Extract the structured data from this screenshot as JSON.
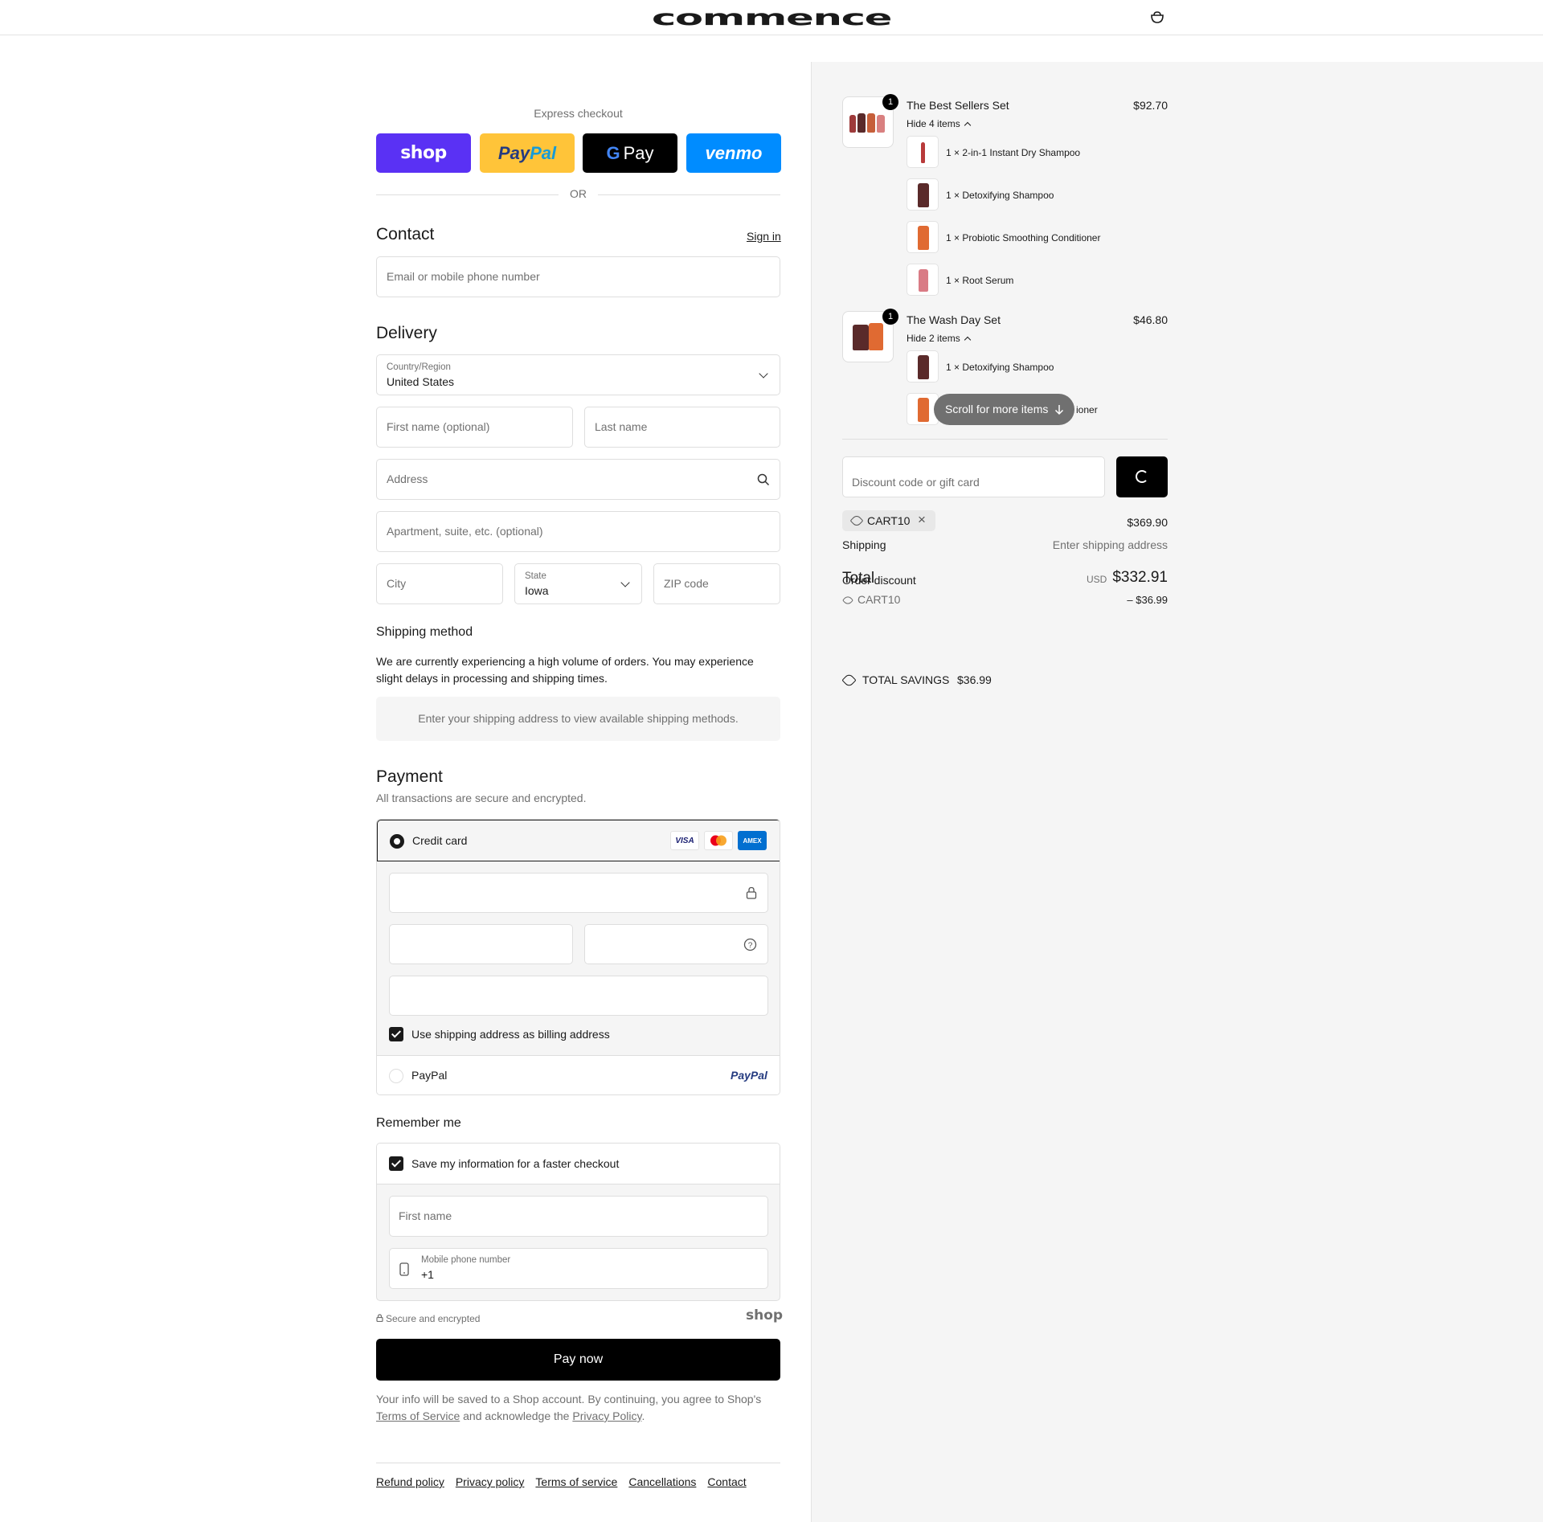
{
  "header": {
    "logo": "commence",
    "bag_icon": "bag-icon"
  },
  "express": {
    "label": "Express checkout",
    "buttons": {
      "shop": "shop",
      "paypal_a": "Pay",
      "paypal_b": "Pal",
      "gpay_g": "G",
      "gpay": "Pay",
      "venmo": "venmo"
    },
    "or": "OR"
  },
  "contact": {
    "title": "Contact",
    "sign_in": "Sign in",
    "email_placeholder": "Email or mobile phone number"
  },
  "delivery": {
    "title": "Delivery",
    "country_label": "Country/Region",
    "country_value": "United States",
    "first_name_placeholder": "First name (optional)",
    "last_name_placeholder": "Last name",
    "address_placeholder": "Address",
    "apartment_placeholder": "Apartment, suite, etc. (optional)",
    "city_placeholder": "City",
    "state_label": "State",
    "state_value": "Iowa",
    "zip_placeholder": "ZIP code"
  },
  "shipping": {
    "title": "Shipping method",
    "notice": "We are currently experiencing a high volume of orders. You may experience slight delays in processing and shipping times.",
    "empty": "Enter your shipping address to view available shipping methods."
  },
  "payment": {
    "title": "Payment",
    "subtitle": "All transactions are secure and encrypted.",
    "credit_card": "Credit card",
    "cards": {
      "visa": "VISA",
      "amex": "AMEX"
    },
    "billing_same": "Use shipping address as billing address",
    "paypal": "PayPal",
    "paypal_logo": "PayPal"
  },
  "remember": {
    "title": "Remember me",
    "save_info": "Save my information for a faster checkout",
    "first_name_placeholder": "First name",
    "phone_label": "Mobile phone number",
    "phone_value": "+1",
    "secure": "Secure and encrypted",
    "shop_logo": "shop"
  },
  "pay_now": "Pay now",
  "legal": {
    "part1": "Your info will be saved to a Shop account. By continuing, you agree to Shop's ",
    "terms": "Terms of Service",
    "part2": " and acknowledge the ",
    "privacy": "Privacy Policy",
    "part3": "."
  },
  "footer_links": [
    "Refund policy",
    "Privacy policy",
    "Terms of service",
    "Cancellations",
    "Contact"
  ],
  "summary": {
    "items": [
      {
        "title": "The Best Sellers Set",
        "price": "$92.70",
        "qty": "1",
        "toggle": "Hide 4 items",
        "sub_items": [
          "2-in-1 Instant Dry Shampoo",
          "Detoxifying Shampoo",
          "Probiotic Smoothing Conditioner",
          "Root Serum"
        ],
        "sub_qty": "1 ×"
      },
      {
        "title": "The Wash Day Set",
        "price": "$46.80",
        "qty": "1",
        "toggle": "Hide 2 items",
        "sub_items": [
          "Detoxifying Shampoo",
          "ioner"
        ],
        "sub_qty": "1 ×"
      }
    ],
    "scroll_hint": "Scroll for more items",
    "discount_placeholder": "Discount code or gift card",
    "applied_code": "CART10",
    "subtotal_value": "$369.90",
    "shipping_label": "Shipping",
    "shipping_value": "Enter shipping address",
    "total_label": "Total",
    "order_discount_label": "Order discount",
    "currency": "USD",
    "total_value": "$332.91",
    "discount_code": "CART10",
    "discount_value": "– $36.99",
    "savings_label": "TOTAL SAVINGS",
    "savings_value": "$36.99"
  },
  "colors": {
    "shop": "#5a31f4",
    "paypal": "#ffc439",
    "venmo": "#008cff",
    "summary_bg": "#f5f5f5"
  }
}
